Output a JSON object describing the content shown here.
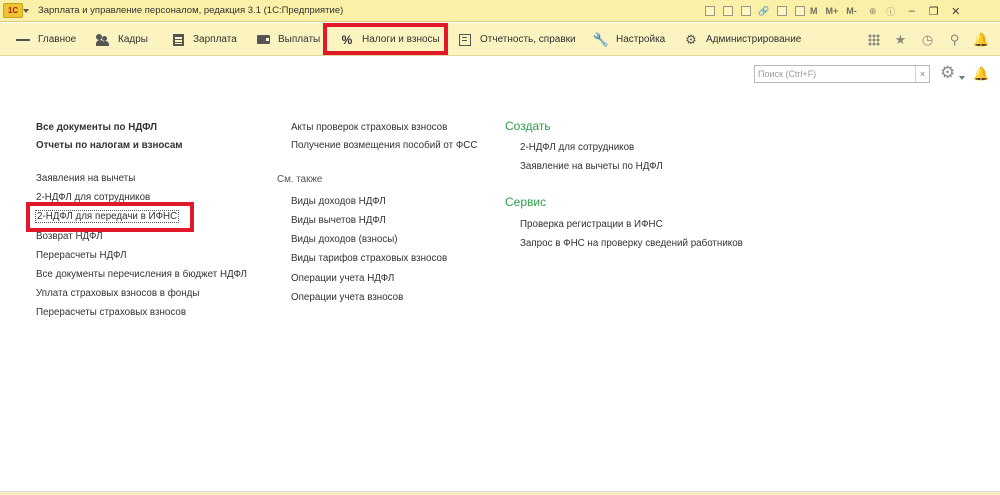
{
  "window": {
    "logo_text": "1С",
    "title": "Зарплата и управление персоналом, редакция 3.1  (1С:Предприятие)",
    "toolbar_texts": [
      "M",
      "M+",
      "M-"
    ],
    "controls": {
      "minimize": "‒",
      "restore": "❐",
      "close": "✕"
    }
  },
  "menu": {
    "items": [
      {
        "label": "Главное",
        "icon": "menu-icon"
      },
      {
        "label": "Кадры",
        "icon": "people-icon"
      },
      {
        "label": "Зарплата",
        "icon": "calculator-icon"
      },
      {
        "label": "Выплаты",
        "icon": "wallet-icon"
      },
      {
        "label": "Налоги и взносы",
        "icon": "percent-icon",
        "selected": true
      },
      {
        "label": "Отчетность, справки",
        "icon": "reports-icon"
      },
      {
        "label": "Настройка",
        "icon": "wrench-icon"
      },
      {
        "label": "Администрирование",
        "icon": "gear-icon"
      }
    ],
    "right_icons": [
      "apps-grid-icon",
      "star-icon",
      "history-icon",
      "search-icon",
      "notifications-icon"
    ]
  },
  "search": {
    "placeholder": "Поиск (Ctrl+F)",
    "clear_label": "×"
  },
  "col1": {
    "bold_links": [
      "Все документы по НДФЛ",
      "Отчеты по налогам и взносам"
    ],
    "links": [
      "Заявления на вычеты",
      "2-НДФЛ для сотрудников",
      "2-НДФЛ для передачи в ИФНС",
      "Возврат НДФЛ",
      "Перерасчеты НДФЛ",
      "Все документы перечисления в бюджет НДФЛ",
      "Уплата страховых взносов в фонды",
      "Перерасчеты страховых взносов"
    ]
  },
  "col2": {
    "links": [
      "Акты проверок страховых взносов",
      "Получение возмещения пособий от ФСС"
    ],
    "see_also_label": "См. также",
    "see_also": [
      "Виды доходов НДФЛ",
      "Виды вычетов НДФЛ",
      "Виды доходов (взносы)",
      "Виды тарифов страховых взносов",
      "Операции учета НДФЛ",
      "Операции учета взносов"
    ]
  },
  "col3": {
    "create_title": "Создать",
    "create": [
      "2-НДФЛ для сотрудников",
      "Заявление на вычеты по НДФЛ"
    ],
    "service_title": "Сервис",
    "service": [
      "Проверка регистрации в ИФНС",
      "Запрос в ФНС на проверку сведений работников"
    ]
  },
  "colors": {
    "accent_red": "#e0182a",
    "section_green": "#2c9e4b",
    "menubar": "#fbf3c0"
  }
}
